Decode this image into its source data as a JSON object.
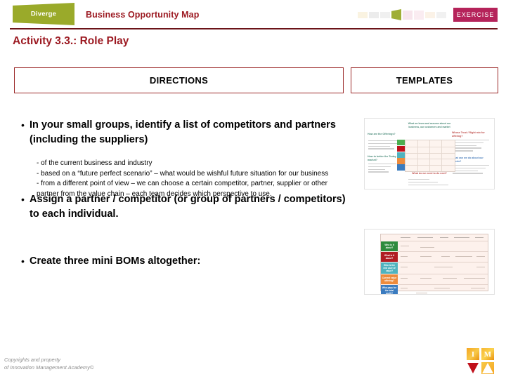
{
  "header": {
    "logo_label": "Diverge",
    "title": "Business Opportunity Map",
    "badge_label": "EXERCISE",
    "accent_red": "#9c1a22",
    "badge_color": "#b5235a",
    "logo_green": "#9aaa2a",
    "rule_color": "#6b1318",
    "process_icon": "process-strip-icon"
  },
  "activity": {
    "title": "Activity 3.3.: Role Play"
  },
  "panels": {
    "directions_label": "DIRECTIONS",
    "templates_label": "TEMPLATES"
  },
  "directions": {
    "bullet_marker": "•",
    "bullets": [
      "In your small groups, identify a list of competitors and partners (including the suppliers)",
      "Assign a partner / competitor (or group of partners / competitors) to each individual.",
      "Create three mini BOMs altogether:"
    ],
    "sub_lines": [
      "- of the current business and industry",
      "- based on a “future perfect scenario” – what would be wishful future situation for our business",
      "- from a different point of view – we can choose a certain competitor, partner, supplier or other partner from the value chain – each team decides which perspective to use."
    ]
  },
  "templates": {
    "thumb1": {
      "name": "business-opportunity-map-template",
      "title_text": "What we know and assume about our business, our customers and market",
      "left_heading": "How are the Offerings?",
      "left_heading2": "How to better the Today market?",
      "right_heading": "Whose Trust / Right mix for offering?",
      "right_heading2": "What can we do about our efforts?",
      "bottom_heading": "What do we need to do next?",
      "swatch_colors": [
        "#4caf50",
        "#c0111b",
        "#4fb3bf",
        "#ed8b3c",
        "#3a7bbf"
      ]
    },
    "thumb2": {
      "name": "role-matrix-template",
      "row_labels": [
        "Who is it about?",
        "What is it about?",
        "Who is the end user of value?",
        "Current value offering?",
        "Who pays for the total profit?"
      ],
      "row_colors": [
        "#2e8b3d",
        "#b01c22",
        "#4fb3bf",
        "#ed8b3c",
        "#3a7bbf"
      ]
    }
  },
  "footer": {
    "copyright_line1": "Copyrights and property",
    "copyright_line2": "of Innovation Management Academy©",
    "logo": {
      "name": "ima-logo",
      "tiles": [
        "I",
        "M",
        "V",
        "A"
      ]
    }
  }
}
